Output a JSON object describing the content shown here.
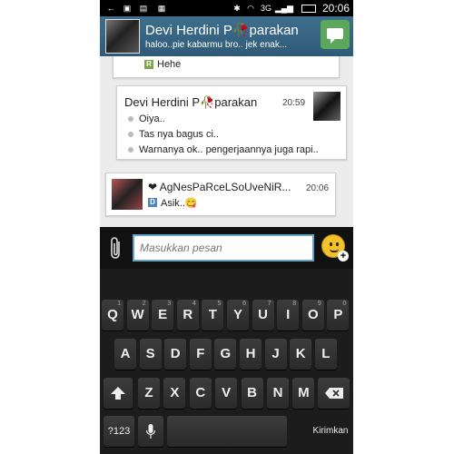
{
  "status_bar": {
    "time": "20:06",
    "network": "3G",
    "icons": [
      "usb-icon",
      "image-icon",
      "gallery-icon",
      "bbm-notify-icon",
      "bluetooth-icon",
      "wifi-icon",
      "signal-icon",
      "battery-icon"
    ]
  },
  "header": {
    "contact_name": "Devi Herdini P🥀parakan",
    "status_message": "haloo..pie kabarmu bro.. jek enak..."
  },
  "messages": [
    {
      "read_tag": "R",
      "text": "Hehe"
    },
    {
      "sender": "Devi Herdini P🥀parakan",
      "time": "20:59",
      "lines": [
        "Oiya..",
        "Tas nya bagus ci..",
        "Warnanya ok.. pengerjaannya juga rapi.."
      ]
    },
    {
      "sender": "❤ AgNesPaRceLSoUveNiR...",
      "time": "20:06",
      "read_tag": "D",
      "text": "Asik..😋"
    }
  ],
  "input": {
    "placeholder": "Masukkan pesan"
  },
  "keyboard": {
    "row1": [
      {
        "k": "Q",
        "h": "1"
      },
      {
        "k": "W",
        "h": "2"
      },
      {
        "k": "E",
        "h": "3"
      },
      {
        "k": "R",
        "h": "4"
      },
      {
        "k": "T",
        "h": "5"
      },
      {
        "k": "Y",
        "h": "6"
      },
      {
        "k": "U",
        "h": "7"
      },
      {
        "k": "I",
        "h": "8"
      },
      {
        "k": "O",
        "h": "9"
      },
      {
        "k": "P",
        "h": "0"
      }
    ],
    "row2": [
      "A",
      "S",
      "D",
      "F",
      "G",
      "H",
      "J",
      "K",
      "L"
    ],
    "row3": [
      "Z",
      "X",
      "C",
      "V",
      "B",
      "N",
      "M"
    ],
    "symbols_label": "?123",
    "send_label": "Kirimkan",
    "colors": {
      "key": "#333333",
      "background": "#1c1c1c",
      "accent": "#6aa3c8"
    }
  }
}
